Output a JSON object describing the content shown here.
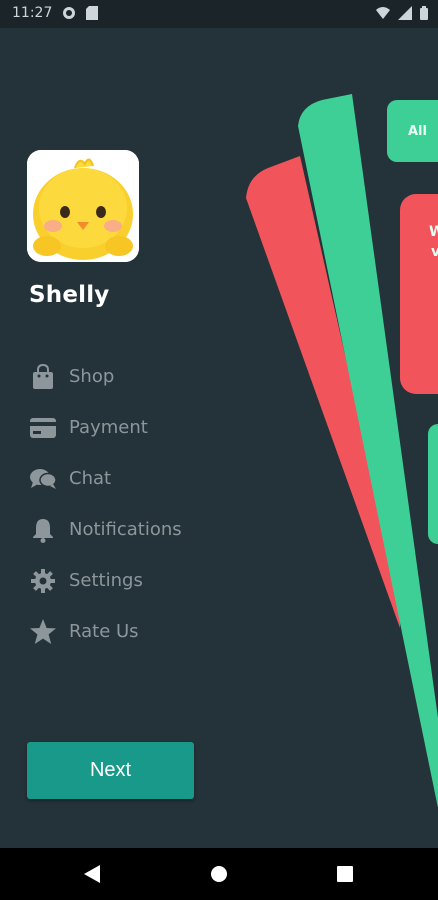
{
  "status_bar": {
    "time": "11:27",
    "left_icons": [
      "app-notification-icon",
      "sd-card-icon"
    ],
    "right_icons": [
      "wifi-icon",
      "signal-icon",
      "battery-icon"
    ]
  },
  "profile": {
    "name": "Shelly",
    "avatar": "yellow-chick-avatar"
  },
  "menu": {
    "items": [
      {
        "label": "Shop",
        "icon": "shopping-bag-icon"
      },
      {
        "label": "Payment",
        "icon": "credit-card-icon"
      },
      {
        "label": "Chat",
        "icon": "chat-bubbles-icon"
      },
      {
        "label": "Notifications",
        "icon": "bell-icon"
      },
      {
        "label": "Settings",
        "icon": "gear-icon"
      },
      {
        "label": "Rate Us",
        "icon": "star-icon"
      }
    ]
  },
  "next_button": {
    "label": "Next"
  },
  "background_cards": {
    "tab_label": "All",
    "red_card_text": "W",
    "red_card_text2": "v",
    "colors": {
      "red": "#f2545b",
      "green": "#3ecf97"
    }
  },
  "nav_bar": {
    "buttons": [
      "back-icon",
      "home-icon",
      "recents-icon"
    ]
  },
  "colors": {
    "background": "#243239",
    "accent": "#18998a",
    "menu_text": "#8d979b",
    "title_text": "#ffffff"
  }
}
